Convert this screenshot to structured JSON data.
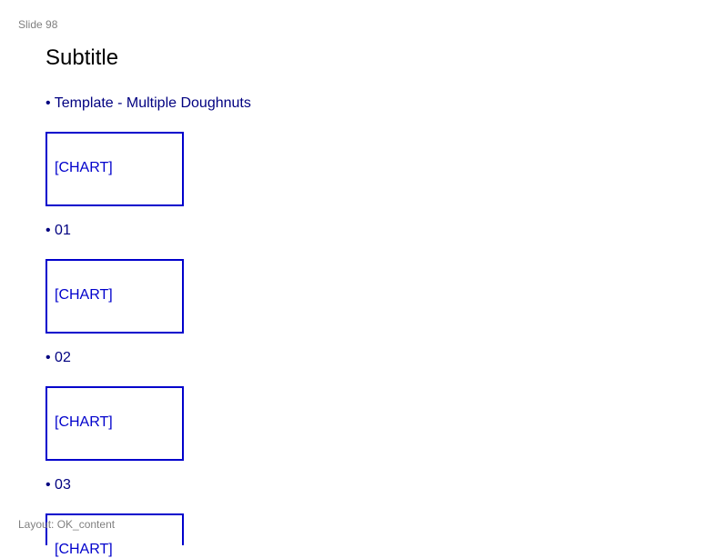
{
  "slide": {
    "label": "Slide 98",
    "subtitle": "Subtitle",
    "layout_label": "Layout: OK_content"
  },
  "items": [
    {
      "bullet": "• Template - Multiple Doughnuts",
      "chart_placeholder": "[CHART]"
    },
    {
      "bullet": "• 01",
      "chart_placeholder": "[CHART]"
    },
    {
      "bullet": "• 02",
      "chart_placeholder": "[CHART]"
    },
    {
      "bullet": "• 03",
      "chart_placeholder": "[CHART]"
    }
  ],
  "colors": {
    "bullet_text": "#000080",
    "placeholder_border": "#0000cc",
    "muted_text": "#808080"
  }
}
